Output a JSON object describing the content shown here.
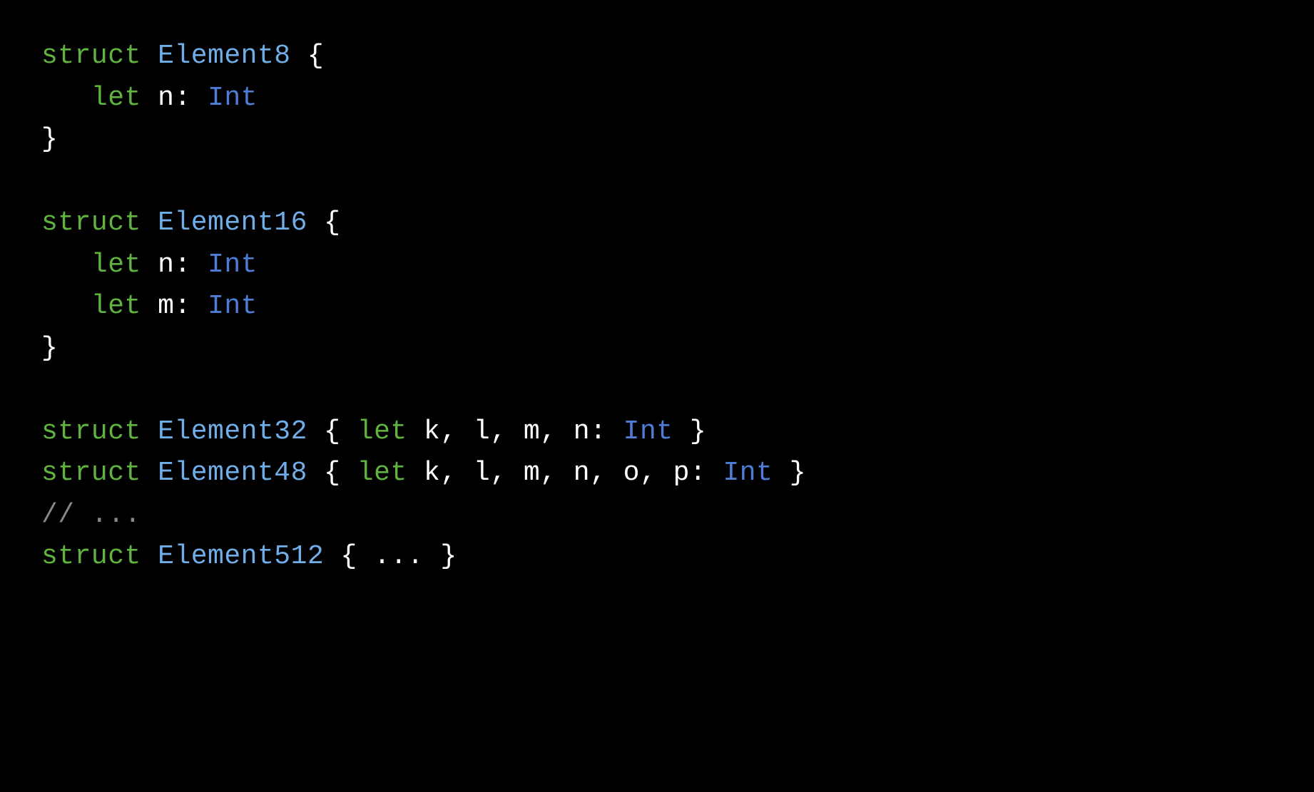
{
  "code": {
    "lines": [
      {
        "tokens": [
          {
            "text": "struct",
            "class": "keyword"
          },
          {
            "text": " ",
            "class": "punctuation"
          },
          {
            "text": "Element8",
            "class": "type-name"
          },
          {
            "text": " {",
            "class": "punctuation"
          }
        ]
      },
      {
        "tokens": [
          {
            "text": "   ",
            "class": "punctuation"
          },
          {
            "text": "let",
            "class": "keyword"
          },
          {
            "text": " n: ",
            "class": "identifier"
          },
          {
            "text": "Int",
            "class": "type"
          }
        ]
      },
      {
        "tokens": [
          {
            "text": "}",
            "class": "punctuation"
          }
        ]
      },
      {
        "tokens": [
          {
            "text": "",
            "class": "punctuation"
          }
        ]
      },
      {
        "tokens": [
          {
            "text": "struct",
            "class": "keyword"
          },
          {
            "text": " ",
            "class": "punctuation"
          },
          {
            "text": "Element16",
            "class": "type-name"
          },
          {
            "text": " {",
            "class": "punctuation"
          }
        ]
      },
      {
        "tokens": [
          {
            "text": "   ",
            "class": "punctuation"
          },
          {
            "text": "let",
            "class": "keyword"
          },
          {
            "text": " n: ",
            "class": "identifier"
          },
          {
            "text": "Int",
            "class": "type"
          }
        ]
      },
      {
        "tokens": [
          {
            "text": "   ",
            "class": "punctuation"
          },
          {
            "text": "let",
            "class": "keyword"
          },
          {
            "text": " m: ",
            "class": "identifier"
          },
          {
            "text": "Int",
            "class": "type"
          }
        ]
      },
      {
        "tokens": [
          {
            "text": "}",
            "class": "punctuation"
          }
        ]
      },
      {
        "tokens": [
          {
            "text": "",
            "class": "punctuation"
          }
        ]
      },
      {
        "tokens": [
          {
            "text": "struct",
            "class": "keyword"
          },
          {
            "text": " ",
            "class": "punctuation"
          },
          {
            "text": "Element32",
            "class": "type-name"
          },
          {
            "text": " { ",
            "class": "punctuation"
          },
          {
            "text": "let",
            "class": "keyword"
          },
          {
            "text": " k, l, m, n: ",
            "class": "identifier"
          },
          {
            "text": "Int",
            "class": "type"
          },
          {
            "text": " }",
            "class": "punctuation"
          }
        ]
      },
      {
        "tokens": [
          {
            "text": "struct",
            "class": "keyword"
          },
          {
            "text": " ",
            "class": "punctuation"
          },
          {
            "text": "Element48",
            "class": "type-name"
          },
          {
            "text": " { ",
            "class": "punctuation"
          },
          {
            "text": "let",
            "class": "keyword"
          },
          {
            "text": " k, l, m, n, o, p: ",
            "class": "identifier"
          },
          {
            "text": "Int",
            "class": "type"
          },
          {
            "text": " }",
            "class": "punctuation"
          }
        ]
      },
      {
        "tokens": [
          {
            "text": "// ...",
            "class": "comment"
          }
        ]
      },
      {
        "tokens": [
          {
            "text": "struct",
            "class": "keyword"
          },
          {
            "text": " ",
            "class": "punctuation"
          },
          {
            "text": "Element512",
            "class": "type-name"
          },
          {
            "text": " { ... }",
            "class": "punctuation"
          }
        ]
      }
    ]
  }
}
